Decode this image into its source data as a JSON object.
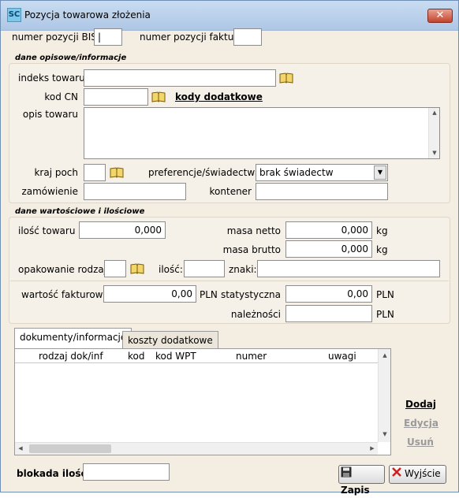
{
  "window": {
    "title": "Pozycja towarowa złożenia",
    "icon_text": "SC",
    "close": "✕"
  },
  "top": {
    "bis_label": "numer pozycji BIS",
    "bis_value": "|",
    "faktura_label": "numer pozycji faktury",
    "faktura_value": ""
  },
  "opisowe": {
    "section_title": "dane opisowe/informacje",
    "indeks_label": "indeks towaru",
    "indeks_value": "",
    "kodcn_label": "kod CN",
    "kodcn_value": "",
    "kody_dodatkowe": "kody dodatkowe",
    "opis_label": "opis towaru",
    "opis_value": "",
    "kraj_label": "kraj poch",
    "kraj_value": "",
    "pref_label": "preferencje/świadectwa",
    "pref_value": "brak świadectw",
    "zamowienie_label": "zamówienie",
    "zamowienie_value": "",
    "kontener_label": "kontener",
    "kontener_value": ""
  },
  "wartosciowe": {
    "section_title": "dane wartościowe i ilościowe",
    "ilosc_label": "ilość towaru",
    "ilosc_value": "0,000",
    "netto_label": "masa netto",
    "netto_value": "0,000",
    "brutto_label": "masa brutto",
    "brutto_value": "0,000",
    "kg1": "kg",
    "kg2": "kg",
    "opak_label": "opakowanie rodzaj",
    "opak_value": "",
    "ilosc2_label": "ilość:",
    "ilosc2_value": "",
    "znaki_label": "znaki:",
    "znaki_value": "",
    "fakt_label": "wartość fakturowa",
    "fakt_value": "0,00",
    "pln1": "PLN",
    "stat_label": "statystyczna",
    "stat_value": "0,00",
    "pln2": "PLN",
    "nal_label": "należności",
    "nal_value": "",
    "pln3": "PLN"
  },
  "tabs": [
    {
      "label": "dokumenty/informacje"
    },
    {
      "label": "koszty dodatkowe"
    }
  ],
  "grid": {
    "columns": [
      "rodzaj dok/inf",
      "kod",
      "kod WPT",
      "numer",
      "uwagi"
    ]
  },
  "side_actions": {
    "dodaj": "Dodaj",
    "edycja": "Edycja",
    "usun": "Usuń"
  },
  "bottom": {
    "blokada_label": "blokada ilości",
    "blokada_value": "",
    "zapis": "Zapis",
    "wyjscie": "Wyjście"
  },
  "colors": {
    "accent_red": "#c4432d",
    "title_bg": "#b9cfea",
    "panel_bg": "#f6f1e8"
  }
}
